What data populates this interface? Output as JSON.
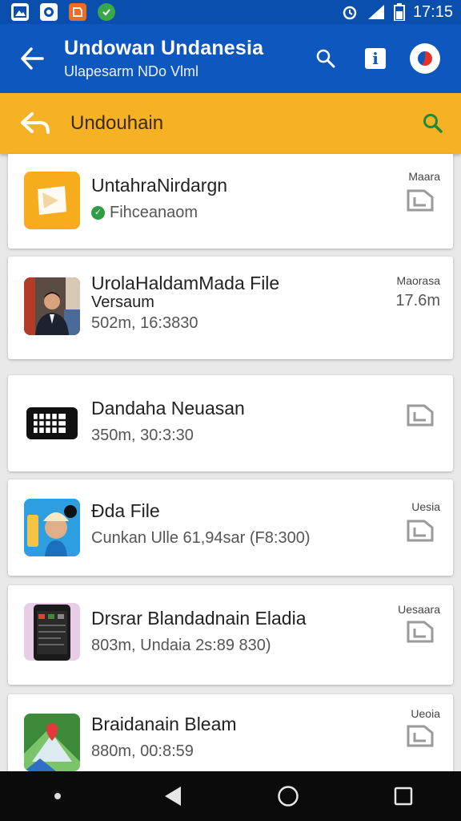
{
  "status_bar": {
    "time": "17:15",
    "icons": [
      "gallery-icon",
      "vpn-icon",
      "app-icon",
      "shield-icon",
      "alarm-icon",
      "signal-icon",
      "battery-icon"
    ]
  },
  "app_bar": {
    "title": "Undowan Undanesia",
    "subtitle": "Ulapesarm NDo Vlml",
    "icons": [
      "back-arrow-icon",
      "search-icon",
      "info-icon",
      "opera-icon"
    ]
  },
  "search_bar": {
    "title": "Undouhain"
  },
  "items": [
    {
      "title": "UntahraNirdargn",
      "subtitle": "Fihceanaom",
      "meta_label": "Maara",
      "thumb_icon": "file-icon",
      "status_icon": "check-icon"
    },
    {
      "title": "UrolaHaldamMada File",
      "version_label": "Versaum",
      "subtitle": "502m, 16:3830",
      "meta_label": "Maorasa",
      "meta_value": "17.6m",
      "thumb_icon": "person-photo"
    },
    {
      "title": "Dandaha Neuasan",
      "subtitle": "350m, 30:3:30",
      "thumb_icon": "sim-card-icon"
    },
    {
      "title": "Ðda File",
      "subtitle": "Cunkan Ulle 61,94sar (F8:300)",
      "meta_label": "Uesia",
      "thumb_icon": "person-sticker"
    },
    {
      "title": "Drsrar Blandadnain Eladia",
      "subtitle": "803m, Undaia 2s:89 830)",
      "meta_label": "Uesaara",
      "thumb_icon": "phone-screenshot"
    },
    {
      "title": "Braidanain Bleam",
      "subtitle": "880m, 00:8:59",
      "meta_label": "Ueoia",
      "thumb_icon": "map-icon"
    }
  ],
  "colors": {
    "status_bar": "#0b4fae",
    "app_bar": "#0d57bf",
    "search_bar": "#f7b125",
    "nav_bar": "#0b0b0b",
    "success": "#2e9d43"
  }
}
